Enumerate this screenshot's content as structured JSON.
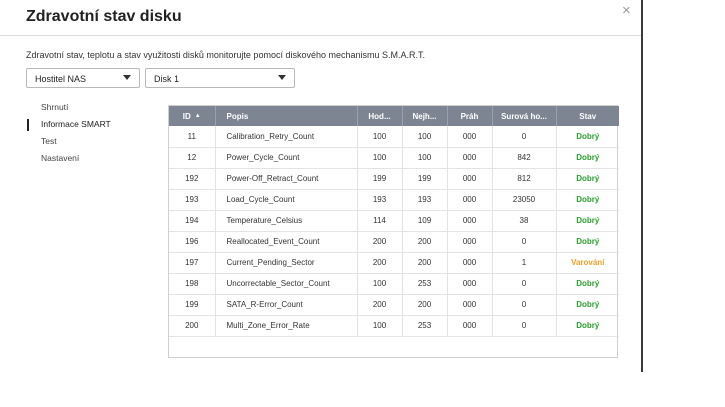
{
  "dialog": {
    "title": "Zdravotní stav disku",
    "close_icon": "×",
    "description": "Zdravotní stav, teplotu a stav využitosti disků monitorujte pomocí diskového mechanismu S.M.A.R.T."
  },
  "selectors": {
    "host": "Hostitel NAS",
    "disk": "Disk 1"
  },
  "nav": {
    "items": [
      {
        "label": "Shrnutí",
        "active": false
      },
      {
        "label": "Informace SMART",
        "active": true
      },
      {
        "label": "Test",
        "active": false
      },
      {
        "label": "Nastavení",
        "active": false
      }
    ]
  },
  "table": {
    "columns": [
      "ID",
      "Popis",
      "Hod...",
      "Nejh...",
      "Práh",
      "Surová ho...",
      "Stav"
    ],
    "sort_icon": "▲",
    "rows": [
      {
        "id": "11",
        "desc": "Calibration_Retry_Count",
        "val": "100",
        "worst": "100",
        "thr": "000",
        "raw": "0",
        "status": "Dobrý"
      },
      {
        "id": "12",
        "desc": "Power_Cycle_Count",
        "val": "100",
        "worst": "100",
        "thr": "000",
        "raw": "842",
        "status": "Dobrý"
      },
      {
        "id": "192",
        "desc": "Power-Off_Retract_Count",
        "val": "199",
        "worst": "199",
        "thr": "000",
        "raw": "812",
        "status": "Dobrý"
      },
      {
        "id": "193",
        "desc": "Load_Cycle_Count",
        "val": "193",
        "worst": "193",
        "thr": "000",
        "raw": "23050",
        "status": "Dobrý"
      },
      {
        "id": "194",
        "desc": "Temperature_Celsius",
        "val": "114",
        "worst": "109",
        "thr": "000",
        "raw": "38",
        "status": "Dobrý"
      },
      {
        "id": "196",
        "desc": "Reallocated_Event_Count",
        "val": "200",
        "worst": "200",
        "thr": "000",
        "raw": "0",
        "status": "Dobrý"
      },
      {
        "id": "197",
        "desc": "Current_Pending_Sector",
        "val": "200",
        "worst": "200",
        "thr": "000",
        "raw": "1",
        "status": "Varování"
      },
      {
        "id": "198",
        "desc": "Uncorrectable_Sector_Count",
        "val": "100",
        "worst": "253",
        "thr": "000",
        "raw": "0",
        "status": "Dobrý"
      },
      {
        "id": "199",
        "desc": "SATA_R-Error_Count",
        "val": "200",
        "worst": "200",
        "thr": "000",
        "raw": "0",
        "status": "Dobrý"
      },
      {
        "id": "200",
        "desc": "Multi_Zone_Error_Rate",
        "val": "100",
        "worst": "253",
        "thr": "000",
        "raw": "0",
        "status": "Dobrý"
      }
    ]
  },
  "colors": {
    "header_bg": "#7d8593",
    "status_ok": "#27a12b",
    "status_warn": "#f0a02a"
  }
}
